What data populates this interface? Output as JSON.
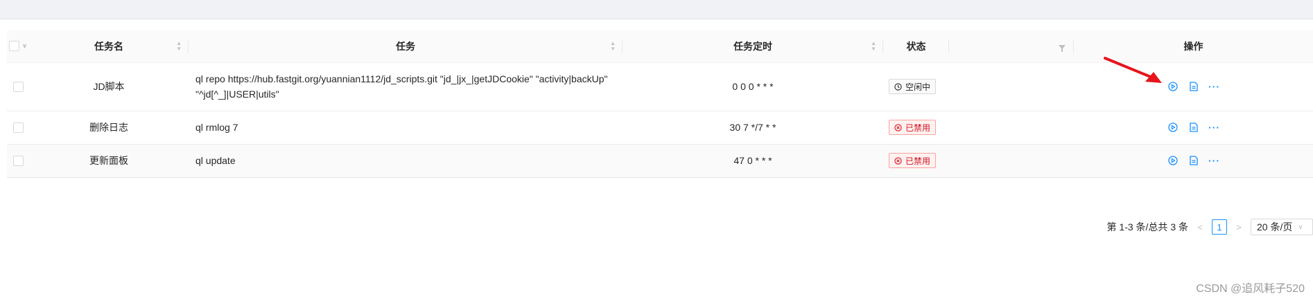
{
  "table": {
    "headers": {
      "name": "任务名",
      "command": "任务",
      "schedule": "任务定时",
      "status": "状态",
      "actions": "操作"
    },
    "rows": [
      {
        "name": "JD脚本",
        "command": "ql repo https://hub.fastgit.org/yuannian1112/jd_scripts.git \"jd_|jx_|getJDCookie\" \"activity|backUp\" \"^jd[^_]|USER|utils\"",
        "schedule": "0 0 0 * * *",
        "status": "空闲中",
        "status_kind": "idle"
      },
      {
        "name": "删除日志",
        "command": "ql rmlog 7",
        "schedule": "30 7 */7 * *",
        "status": "已禁用",
        "status_kind": "disabled"
      },
      {
        "name": "更新面板",
        "command": "ql update",
        "schedule": "47 0 * * *",
        "status": "已禁用",
        "status_kind": "disabled"
      }
    ],
    "action_icons": [
      "play-circle-icon",
      "file-text-icon",
      "more-icon"
    ]
  },
  "pagination": {
    "summary": "第 1-3 条/总共 3 条",
    "current_page": "1",
    "page_size": "20 条/页"
  },
  "colors": {
    "primary": "#1890ff",
    "danger": "#cf1322",
    "arrow": "#e8141c"
  },
  "watermark": "CSDN @追风耗子520"
}
